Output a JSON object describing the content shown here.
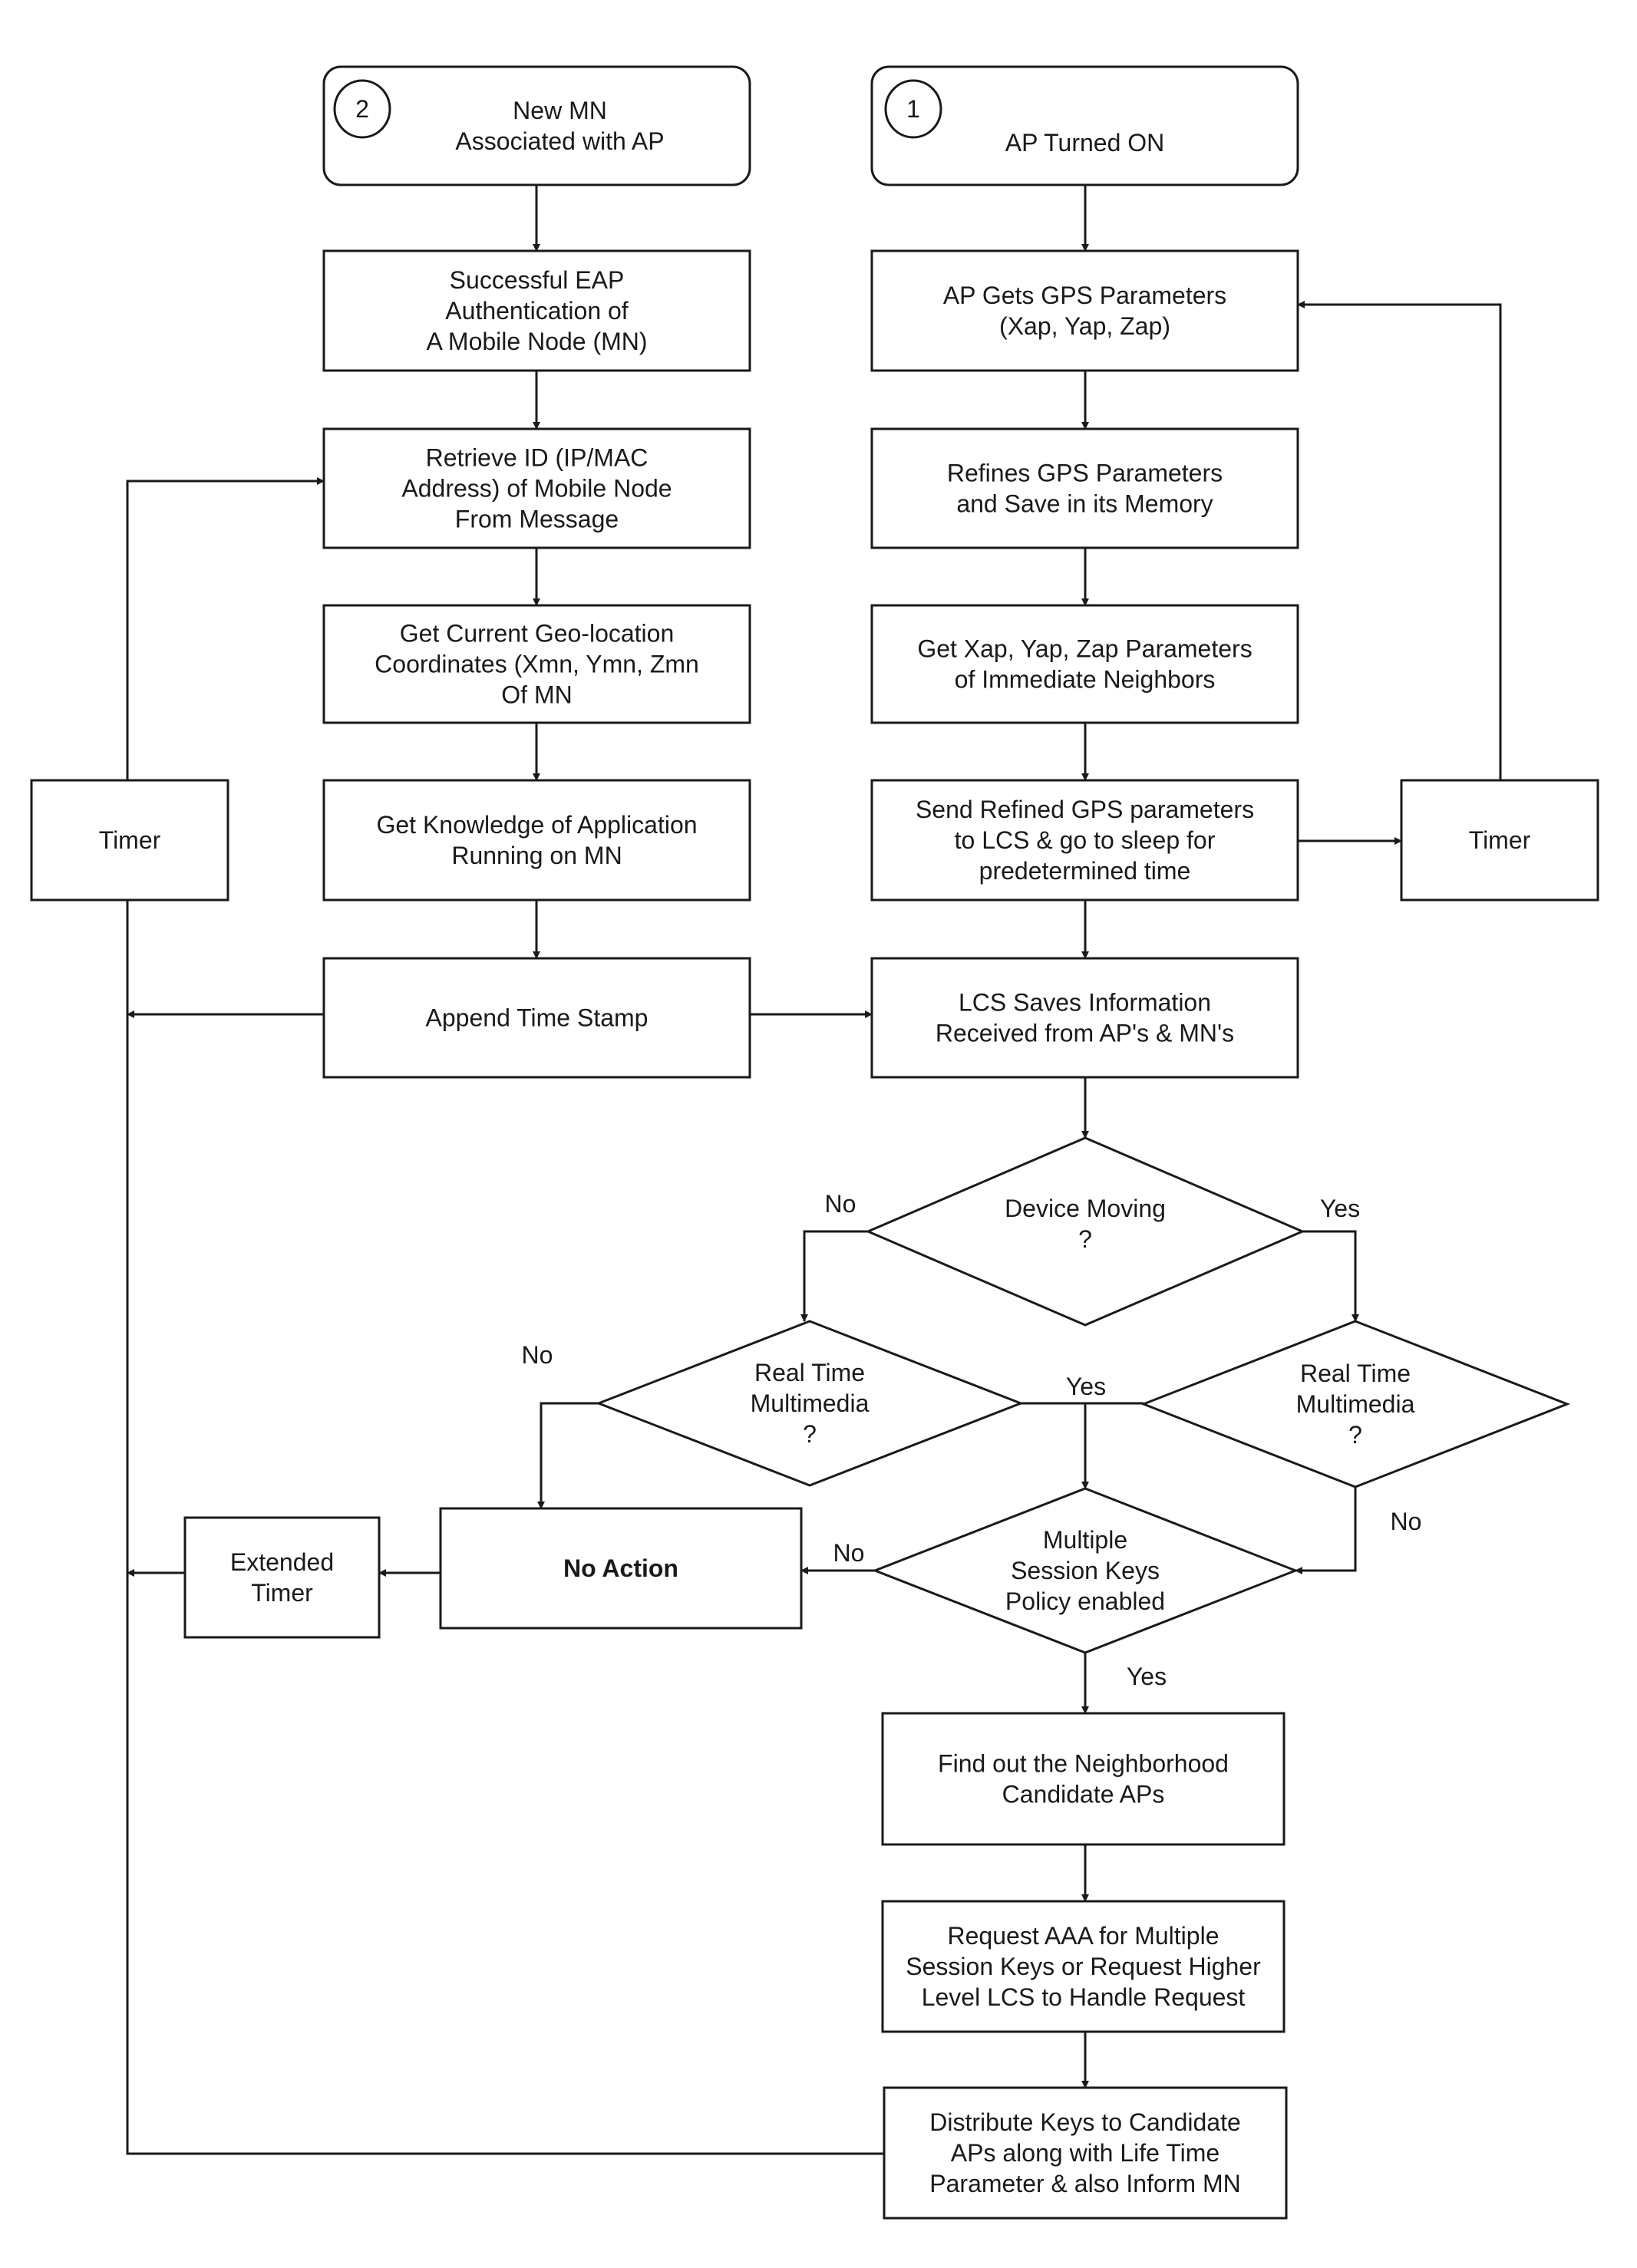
{
  "diagram": {
    "type": "flowchart",
    "colors": {
      "stroke": "#1a1a1a",
      "fill": "#ffffff",
      "text": "#1a1a1a"
    },
    "nodes": {
      "new_mn": {
        "badge": "2",
        "lines": [
          "New MN",
          "Associated with AP"
        ]
      },
      "ap_on": {
        "badge": "1",
        "lines": [
          "AP Turned ON"
        ]
      },
      "eap_auth": {
        "lines": [
          "Successful EAP",
          "Authentication of",
          "A Mobile Node (MN)"
        ]
      },
      "ap_gps": {
        "lines": [
          "AP Gets GPS Parameters",
          "(Xap, Yap, Zap)"
        ]
      },
      "retrieve_id": {
        "lines": [
          "Retrieve ID (IP/MAC",
          "Address) of  Mobile Node",
          "From Message"
        ]
      },
      "refine_gps": {
        "lines": [
          "Refines GPS Parameters",
          "and Save in its Memory"
        ]
      },
      "geo_coords": {
        "lines": [
          "Get Current Geo-location",
          "Coordinates (Xmn, Ymn, Zmn",
          "Of MN"
        ]
      },
      "neighbors": {
        "lines": [
          "Get Xap, Yap, Zap Parameters",
          "of Immediate Neighbors"
        ]
      },
      "app_knowledge": {
        "lines": [
          "Get Knowledge of Application",
          "Running on MN"
        ]
      },
      "send_gps": {
        "lines": [
          "Send Refined GPS parameters",
          "to LCS & go to sleep for",
          "predetermined time"
        ]
      },
      "timer_left": {
        "lines": [
          "Timer"
        ]
      },
      "timer_right": {
        "lines": [
          "Timer"
        ]
      },
      "timestamp": {
        "lines": [
          "Append Time Stamp"
        ]
      },
      "lcs_saves": {
        "lines": [
          "LCS Saves Information",
          "Received from AP's &  MN's"
        ]
      },
      "device_moving": {
        "lines": [
          "Device Moving",
          "?"
        ]
      },
      "rtm_left": {
        "lines": [
          "Real Time",
          "Multimedia",
          "?"
        ]
      },
      "rtm_right": {
        "lines": [
          "Real Time",
          "Multimedia",
          "?"
        ]
      },
      "msk_policy": {
        "lines": [
          "Multiple",
          "Session Keys",
          "Policy enabled"
        ]
      },
      "no_action": {
        "lines": [
          "No Action"
        ]
      },
      "extended_timer": {
        "lines": [
          "Extended",
          "Timer"
        ]
      },
      "find_neighbors": {
        "lines": [
          "Find out the Neighborhood",
          "Candidate APs"
        ]
      },
      "request_aaa": {
        "lines": [
          "Request AAA for Multiple",
          "Session Keys or Request Higher",
          "Level LCS to Handle Request"
        ]
      },
      "distribute_keys": {
        "lines": [
          "Distribute Keys to Candidate",
          "APs along with Life Time",
          "Parameter & also Inform MN"
        ]
      }
    },
    "edge_labels": {
      "dm_no": "No",
      "dm_yes": "Yes",
      "rtml_no": "No",
      "rtml_yes": "Yes",
      "rtmr_no": "No",
      "msk_no": "No",
      "msk_yes": "Yes"
    }
  }
}
